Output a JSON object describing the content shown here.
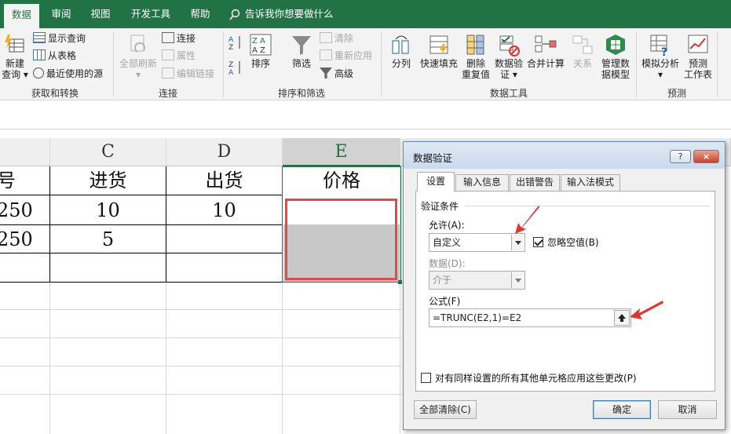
{
  "ribbon_tabs": [
    "数据",
    "审阅",
    "视图",
    "开发工具",
    "帮助"
  ],
  "tell_me": "告诉我你想要做什么",
  "ribbon": {
    "get_transform": {
      "new_query": [
        "新建",
        "查询"
      ],
      "show_queries": "显示查询",
      "from_table": "从表格",
      "recent_sources": "最近使用的源",
      "label": "获取和转换"
    },
    "connections": {
      "refresh_all": "全部刷新",
      "connections": "连接",
      "properties": "属性",
      "edit_links": "编辑链接",
      "label": "连接"
    },
    "sort_filter": {
      "sort": "排序",
      "filter": "筛选",
      "clear": "清除",
      "reapply": "重新应用",
      "advanced": "高级",
      "label": "排序和筛选"
    },
    "data_tools": {
      "split": "分列",
      "flash_fill": "快速填充",
      "remove_dup": [
        "删除",
        "重复值"
      ],
      "validation": [
        "数据验",
        "证"
      ],
      "consolidate": "合并计算",
      "relationships": "关系",
      "data_model": [
        "管理数",
        "据模型"
      ],
      "label": "数据工具"
    },
    "forecast": {
      "what_if": "模拟分析",
      "forecast_sheet": [
        "预测",
        "工作表"
      ],
      "label": "预测"
    }
  },
  "sheet": {
    "columns": [
      "C",
      "D",
      "E"
    ],
    "header_row": {
      "b": "号",
      "c": "进货",
      "d": "出货",
      "e": "价格"
    },
    "rows": [
      {
        "b": "250",
        "c": "10",
        "d": "10",
        "e": ""
      },
      {
        "b": "250",
        "c": "5",
        "d": "",
        "e": ""
      }
    ]
  },
  "dialog": {
    "title": "数据验证",
    "help": "?",
    "close": "×",
    "tabs": [
      "设置",
      "输入信息",
      "出错警告",
      "输入法模式"
    ],
    "section": "验证条件",
    "allow_label": "允许(A):",
    "allow_value": "自定义",
    "ignore_blank": "忽略空值(B)",
    "ignore_blank_checked": true,
    "data_label": "数据(D):",
    "data_value": "介于",
    "formula_label": "公式(F)",
    "formula_value": "=TRUNC(E2,1)=E2",
    "apply_all": "对有同样设置的所有其他单元格应用这些更改(P)",
    "apply_all_checked": false,
    "clear_all": "全部清除(C)",
    "ok": "确定",
    "cancel": "取消"
  },
  "colors": {
    "excel_green": "#217346",
    "highlight_red": "#e8474a",
    "arrow_red": "#e6332a",
    "selected_fill": "#c8c8c8"
  }
}
